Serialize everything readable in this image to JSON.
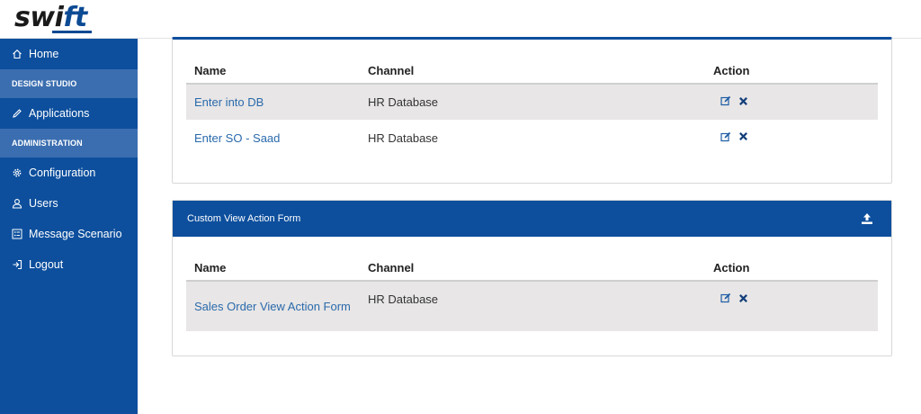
{
  "app": {
    "logo_prefix": "swi",
    "logo_suffix": "ft"
  },
  "sidebar": {
    "items": [
      {
        "label": "Home",
        "icon": "home-icon"
      },
      {
        "section": "DESIGN STUDIO"
      },
      {
        "label": "Applications",
        "icon": "pencil-icon"
      },
      {
        "section": "ADMINISTRATION"
      },
      {
        "label": "Configuration",
        "icon": "gear-icon"
      },
      {
        "label": "Users",
        "icon": "user-icon"
      },
      {
        "label": "Message Scenario",
        "icon": "list-icon"
      },
      {
        "label": "Logout",
        "icon": "logout-icon"
      }
    ]
  },
  "table1": {
    "headers": {
      "name": "Name",
      "channel": "Channel",
      "action": "Action"
    },
    "rows": [
      {
        "name": "Enter into DB",
        "channel": "HR Database"
      },
      {
        "name": "Enter SO - Saad",
        "channel": "HR Database"
      }
    ]
  },
  "card2": {
    "title": "Custom View Action Form",
    "headers": {
      "name": "Name",
      "channel": "Channel",
      "action": "Action"
    },
    "rows": [
      {
        "name": "Sales Order View Action Form",
        "channel": "HR Database"
      }
    ]
  },
  "colors": {
    "brand": "#0d4f9d",
    "section": "#3b6eb0",
    "link": "#2a6aac",
    "row_alt": "#e8e6e6"
  }
}
